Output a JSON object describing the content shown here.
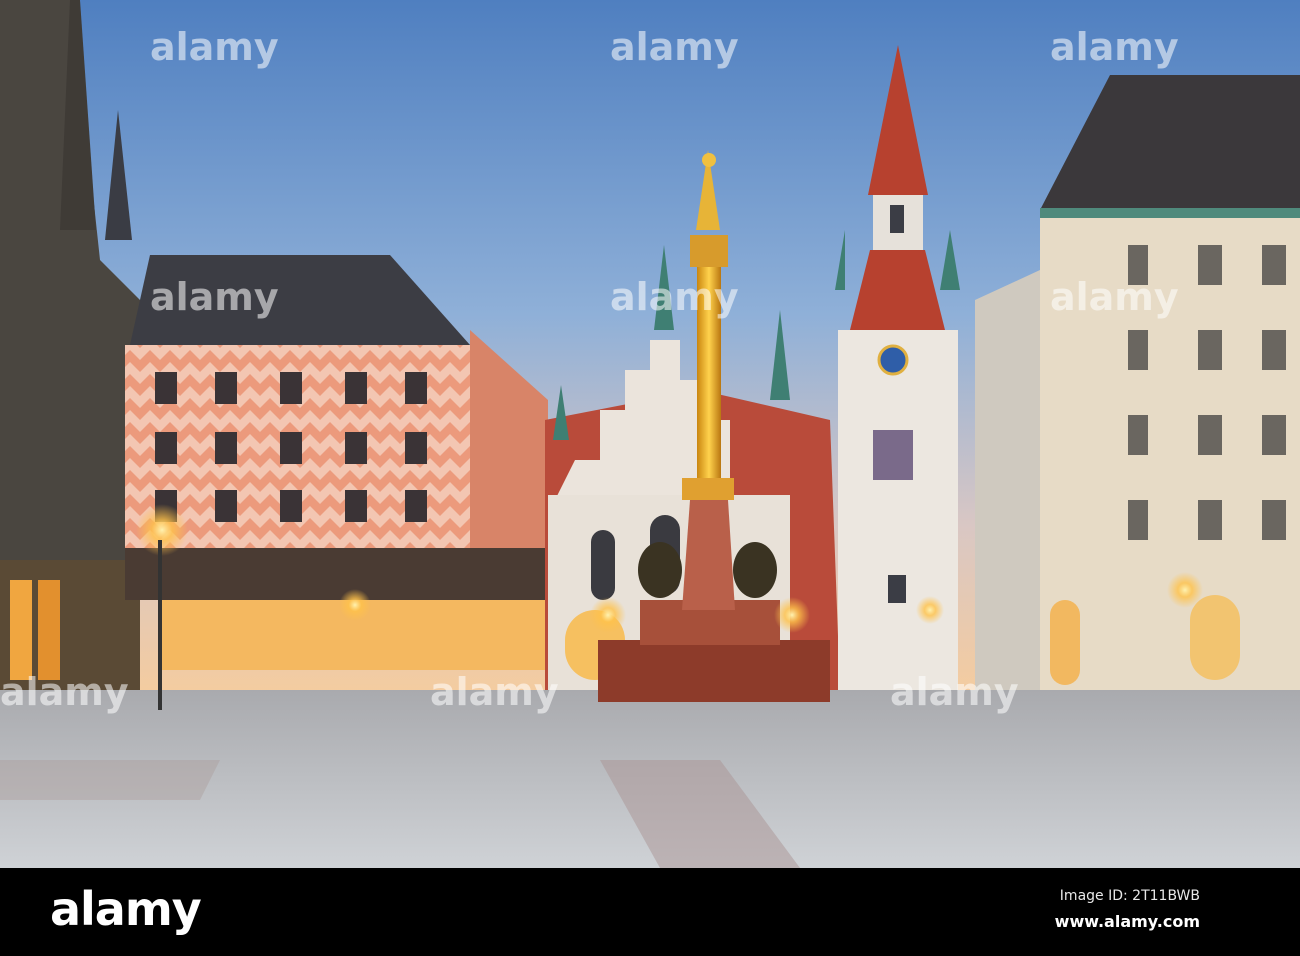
{
  "photo": {
    "subject": "Marienplatz square at dawn",
    "watermark": "alamy"
  },
  "footer": {
    "logo": "alamy",
    "image_id": "Image ID: 2T11BWB",
    "website": "www.alamy.com"
  },
  "colors": {
    "sky_top": "#5b86c2",
    "sky_horizon": "#f2c9a2",
    "facade_orange": "#e9896b",
    "roof": "#3c3d44",
    "plaza": "#bfc2c6",
    "lamp": "#ffc24a"
  }
}
